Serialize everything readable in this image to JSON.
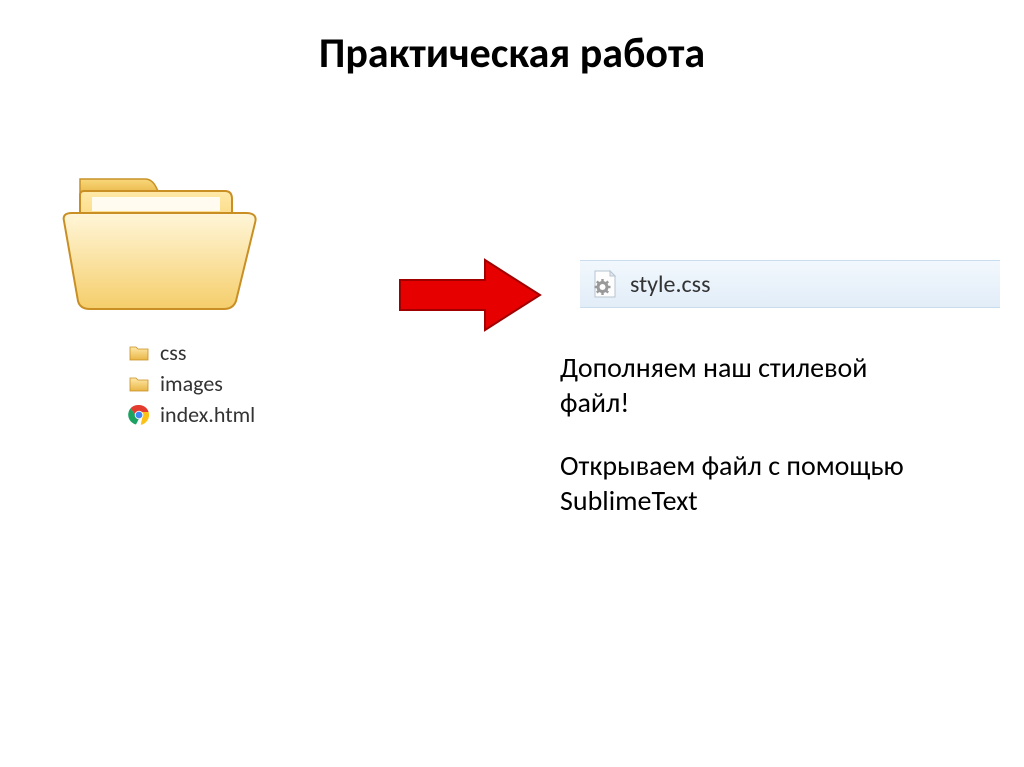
{
  "title": "Практическая работа",
  "files": {
    "css": "css",
    "images": "images",
    "index": "index.html"
  },
  "styleFile": "style.css",
  "instructions": {
    "line1": "Дополняем наш стилевой файл!",
    "line2": "Открываем файл с помощью SublimeText"
  }
}
